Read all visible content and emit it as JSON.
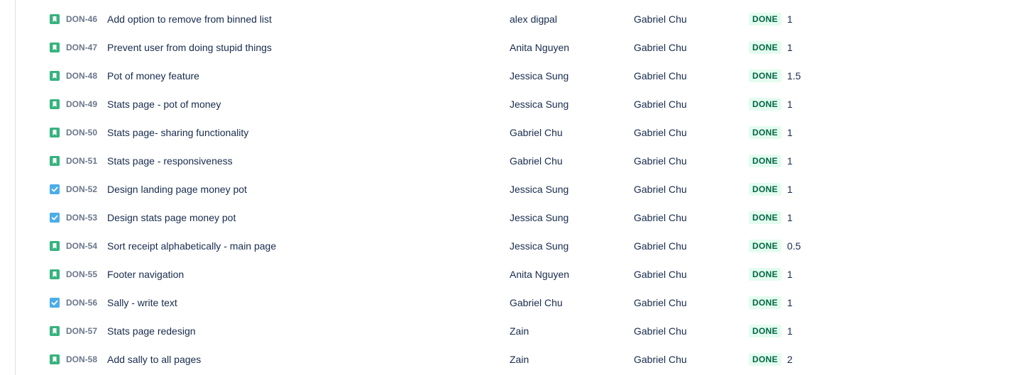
{
  "colors": {
    "story_icon": "#36b37e",
    "task_icon": "#4bade8",
    "done_bg": "#e3fcef",
    "done_text": "#006644"
  },
  "issues": [
    {
      "type": "story",
      "icon": "bookmark-icon",
      "key": "DON-46",
      "summary": "Add option to remove from binned list",
      "assignee": "alex digpal",
      "reporter": "Gabriel Chu",
      "status": "DONE",
      "points": "1"
    },
    {
      "type": "story",
      "icon": "bookmark-icon",
      "key": "DON-47",
      "summary": "Prevent user from doing stupid things",
      "assignee": "Anita Nguyen",
      "reporter": "Gabriel Chu",
      "status": "DONE",
      "points": "1"
    },
    {
      "type": "story",
      "icon": "bookmark-icon",
      "key": "DON-48",
      "summary": "Pot of money feature",
      "assignee": "Jessica Sung",
      "reporter": "Gabriel Chu",
      "status": "DONE",
      "points": "1.5"
    },
    {
      "type": "story",
      "icon": "bookmark-icon",
      "key": "DON-49",
      "summary": "Stats page - pot of money",
      "assignee": "Jessica Sung",
      "reporter": "Gabriel Chu",
      "status": "DONE",
      "points": "1"
    },
    {
      "type": "story",
      "icon": "bookmark-icon",
      "key": "DON-50",
      "summary": "Stats page- sharing functionality",
      "assignee": "Gabriel Chu",
      "reporter": "Gabriel Chu",
      "status": "DONE",
      "points": "1"
    },
    {
      "type": "story",
      "icon": "bookmark-icon",
      "key": "DON-51",
      "summary": "Stats page - responsiveness",
      "assignee": "Gabriel Chu",
      "reporter": "Gabriel Chu",
      "status": "DONE",
      "points": "1"
    },
    {
      "type": "task",
      "icon": "checkbox-icon",
      "key": "DON-52",
      "summary": "Design landing page money pot",
      "assignee": "Jessica Sung",
      "reporter": "Gabriel Chu",
      "status": "DONE",
      "points": "1"
    },
    {
      "type": "task",
      "icon": "checkbox-icon",
      "key": "DON-53",
      "summary": "Design stats page money pot",
      "assignee": "Jessica Sung",
      "reporter": "Gabriel Chu",
      "status": "DONE",
      "points": "1"
    },
    {
      "type": "story",
      "icon": "bookmark-icon",
      "key": "DON-54",
      "summary": "Sort receipt alphabetically - main page",
      "assignee": "Jessica Sung",
      "reporter": "Gabriel Chu",
      "status": "DONE",
      "points": "0.5"
    },
    {
      "type": "story",
      "icon": "bookmark-icon",
      "key": "DON-55",
      "summary": "Footer navigation",
      "assignee": "Anita Nguyen",
      "reporter": "Gabriel Chu",
      "status": "DONE",
      "points": "1"
    },
    {
      "type": "task",
      "icon": "checkbox-icon",
      "key": "DON-56",
      "summary": "Sally - write text",
      "assignee": "Gabriel Chu",
      "reporter": "Gabriel Chu",
      "status": "DONE",
      "points": "1"
    },
    {
      "type": "story",
      "icon": "bookmark-icon",
      "key": "DON-57",
      "summary": "Stats page redesign",
      "assignee": "Zain",
      "reporter": "Gabriel Chu",
      "status": "DONE",
      "points": "1"
    },
    {
      "type": "story",
      "icon": "bookmark-icon",
      "key": "DON-58",
      "summary": "Add sally to all pages",
      "assignee": "Zain",
      "reporter": "Gabriel Chu",
      "status": "DONE",
      "points": "2"
    }
  ]
}
